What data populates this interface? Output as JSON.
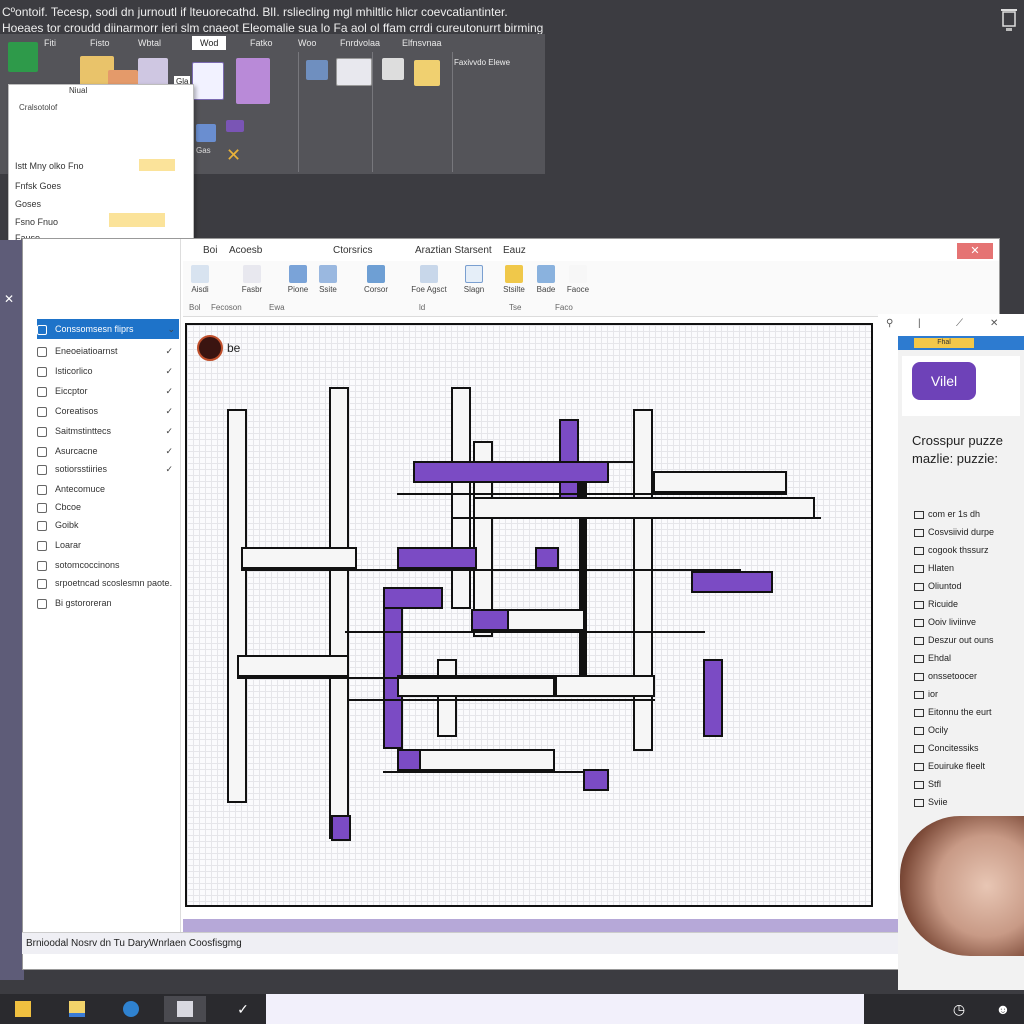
{
  "caption": {
    "line1": "Cºontoif. Tecesp, sodi dn jurnoutl if lteuorecathd. BlI. rsliecling mgl mhiltlic hlicr coevcatiantinter.",
    "line2": "Hoeaes tor croudd diinarmorr ieri slm cnaeot Eleomalie sua lo Fa aol ol ffam crrdi cureutonurrt birming"
  },
  "top_ribbon": {
    "tabs": [
      "Fiti",
      "Fisto",
      "Wbtal",
      "Wod",
      "Fatko",
      "Woo",
      "Fnrdvolaa",
      "Elfnsvnaa"
    ],
    "active_tab": "Wod",
    "labels": [
      "Gla",
      "Gas",
      "Faxivvdo Elewe"
    ]
  },
  "float_panel": {
    "title": "Cralsotolof",
    "header_tag": "Niual",
    "rows": [
      "Istt  Mny olko  Fno",
      "Fnfsk  Goes",
      "Goses",
      "Fsno  Fnuo",
      "Fauso"
    ]
  },
  "window": {
    "menu": [
      "Boi",
      "Acoesb",
      "Ctorsrics",
      "Araztian Starsent",
      "Eauz"
    ],
    "ribbon_buttons": [
      "Aisdi",
      "Fasbr",
      "Pione",
      "Ssite",
      "Corsor",
      "Foe Agsct",
      "Slagn",
      "Stsilte",
      "Bade",
      "Faoce"
    ],
    "groups": [
      "Bol",
      "Fecoson",
      "Ewa",
      "ld",
      "Tse",
      "Faco"
    ]
  },
  "sidebar": {
    "items": [
      {
        "label": "Conssomsesn fliprs",
        "selected": true
      },
      {
        "label": "Eneoeiatioarnst",
        "selected": false
      },
      {
        "label": "Isticorlico",
        "selected": false
      },
      {
        "label": "Eiccptor",
        "selected": false
      },
      {
        "label": "Coreatisos",
        "selected": false
      },
      {
        "label": "Saitmstinttecs",
        "selected": false
      },
      {
        "label": "Asurcacne",
        "selected": false
      },
      {
        "label": "sotiorsstiiries",
        "selected": false
      },
      {
        "label": "Antecomuce",
        "selected": false
      },
      {
        "label": "Cbcoe",
        "selected": false
      },
      {
        "label": "Goibk",
        "selected": false
      },
      {
        "label": "Loarar",
        "selected": false
      },
      {
        "label": "sotomcoccinons",
        "selected": false
      },
      {
        "label": "srpoetncad scoslesmn paote.",
        "selected": false
      },
      {
        "label": "Bi  gstororeran",
        "selected": false
      }
    ]
  },
  "canvas": {
    "badge_text": "be"
  },
  "right_panel": {
    "tag": "Fhal",
    "logo_text": "Vilel",
    "title": "Crosspur puzze mazlie: puzzie:",
    "items": [
      "com er 1s dh",
      "Cosvsiivid durpe",
      "cogook thssurz",
      "Hlaten",
      "Oliuntod",
      "Ricuide",
      "Ooiv liviinve",
      "Deszur out ouns",
      "Ehdal",
      "onssetoocer",
      "ior",
      "Eitonnu the eurt",
      "Ocily",
      "Concitessiks",
      "Eouiruke fleelt",
      "Stfl",
      "Sviie"
    ]
  },
  "status_bar": {
    "text": "Brnioodal    Nosrv dn    Tu DaryWnrlaen    Coosfisgmg"
  },
  "colors": {
    "accent_purple": "#7b4bc4",
    "selected_blue": "#1e73c9",
    "close_red": "#e57373"
  }
}
